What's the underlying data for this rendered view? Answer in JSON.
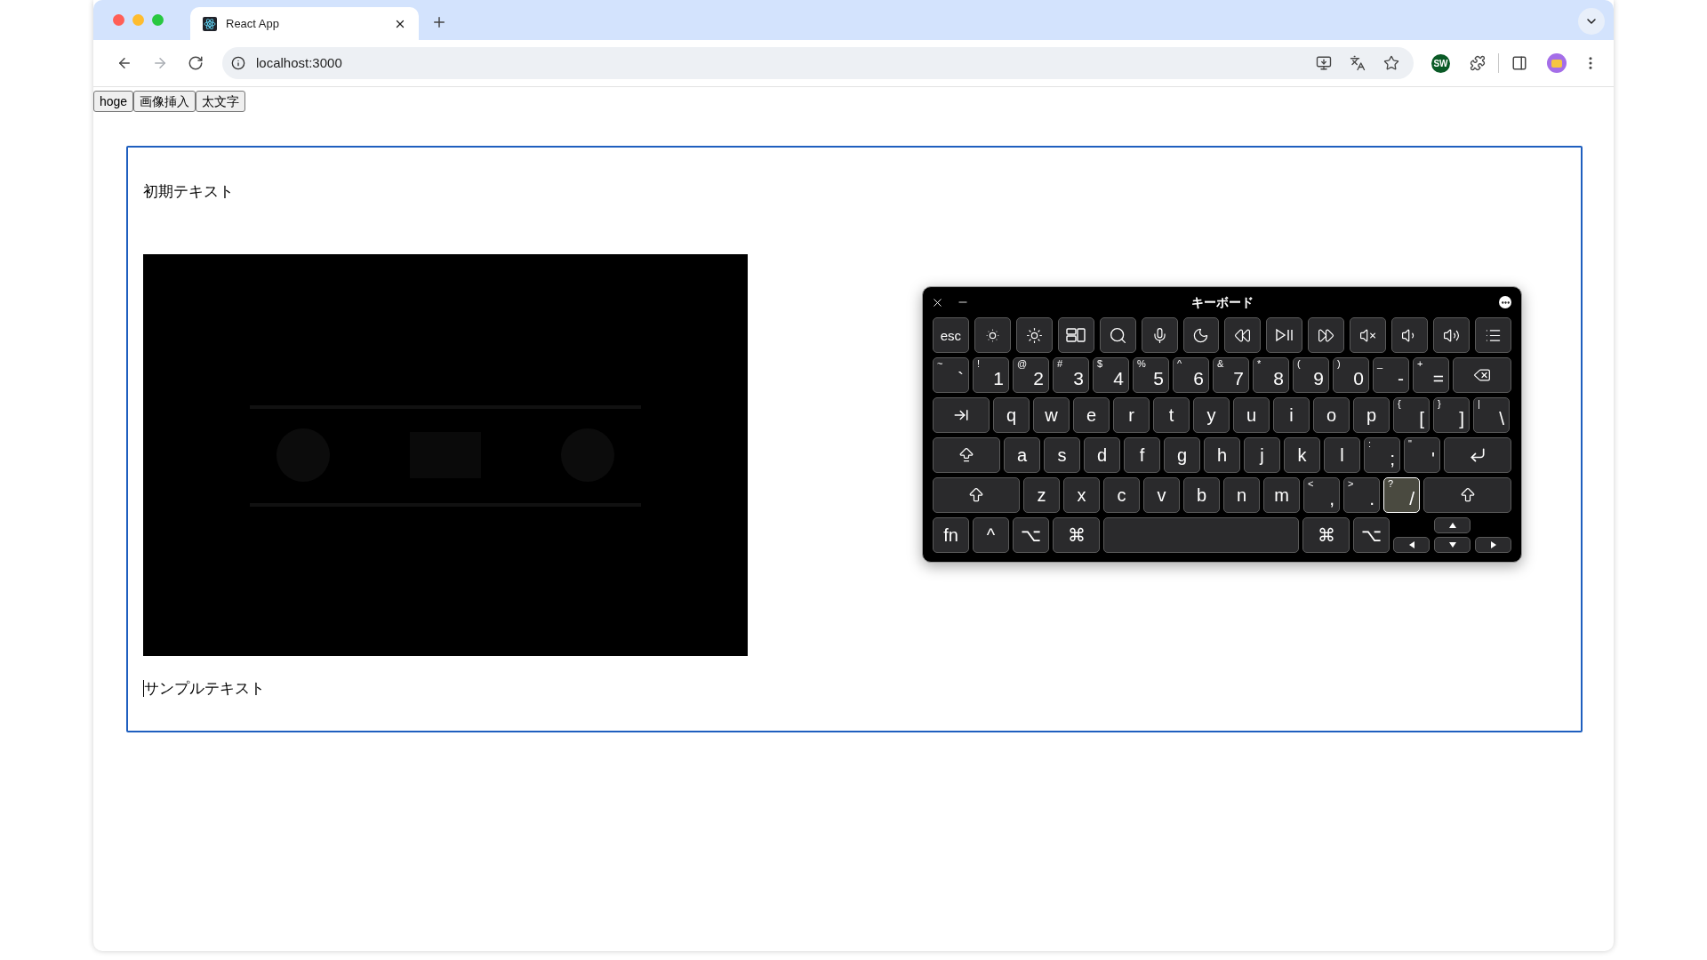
{
  "browser": {
    "tabs": [
      {
        "title": "React App",
        "selected": true
      }
    ],
    "nav": [
      {
        "kind": "back",
        "disabled": false
      },
      {
        "kind": "forward",
        "disabled": true
      },
      {
        "kind": "reload",
        "disabled": false
      }
    ],
    "address": "localhost:3000",
    "extension_badge": "SW"
  },
  "toolbar": {
    "buttons": [
      "hoge",
      "画像挿入",
      "太文字"
    ]
  },
  "editor": {
    "blocks": [
      {
        "kind": "text",
        "text": "初期テキスト",
        "caret": false
      },
      {
        "kind": "picture"
      },
      {
        "kind": "text",
        "text": "サンプルテキスト",
        "caret": true
      }
    ]
  },
  "keyboard": {
    "title": "キーボード",
    "key_rows": [
      [
        {
          "kind": "label",
          "text": "esc",
          "pressed": false
        },
        {
          "kind": "brightness-down",
          "pressed": false
        },
        {
          "kind": "brightness-up",
          "pressed": false
        },
        {
          "kind": "mission-control",
          "pressed": false
        },
        {
          "kind": "search",
          "pressed": false
        },
        {
          "kind": "mic",
          "pressed": false
        },
        {
          "kind": "moon",
          "pressed": false
        },
        {
          "kind": "rewind",
          "pressed": false
        },
        {
          "kind": "play-pause",
          "pressed": false
        },
        {
          "kind": "fast-forward",
          "pressed": false
        },
        {
          "kind": "mute",
          "pressed": false
        },
        {
          "kind": "volume-down",
          "pressed": false
        },
        {
          "kind": "volume-up",
          "pressed": false
        },
        {
          "kind": "list",
          "pressed": false
        }
      ],
      [
        {
          "kind": "char",
          "main": "`",
          "shift": "~",
          "pressed": false
        },
        {
          "kind": "char",
          "main": "1",
          "shift": "!",
          "pressed": false
        },
        {
          "kind": "char",
          "main": "2",
          "shift": "@",
          "pressed": false
        },
        {
          "kind": "char",
          "main": "3",
          "shift": "#",
          "pressed": false
        },
        {
          "kind": "char",
          "main": "4",
          "shift": "$",
          "pressed": false
        },
        {
          "kind": "char",
          "main": "5",
          "shift": "%",
          "pressed": false
        },
        {
          "kind": "char",
          "main": "6",
          "shift": "^",
          "pressed": false
        },
        {
          "kind": "char",
          "main": "7",
          "shift": "&",
          "pressed": false
        },
        {
          "kind": "char",
          "main": "8",
          "shift": "*",
          "pressed": false
        },
        {
          "kind": "char",
          "main": "9",
          "shift": "(",
          "pressed": false
        },
        {
          "kind": "char",
          "main": "0",
          "shift": ")",
          "pressed": false
        },
        {
          "kind": "char",
          "main": "-",
          "shift": "_",
          "pressed": false
        },
        {
          "kind": "char",
          "main": "=",
          "shift": "+",
          "pressed": false
        },
        {
          "kind": "delete",
          "pressed": false
        }
      ],
      [
        {
          "kind": "tab",
          "pressed": false
        },
        {
          "kind": "char",
          "main": "q",
          "pressed": false
        },
        {
          "kind": "char",
          "main": "w",
          "pressed": false
        },
        {
          "kind": "char",
          "main": "e",
          "pressed": false
        },
        {
          "kind": "char",
          "main": "r",
          "pressed": false
        },
        {
          "kind": "char",
          "main": "t",
          "pressed": false
        },
        {
          "kind": "char",
          "main": "y",
          "pressed": false
        },
        {
          "kind": "char",
          "main": "u",
          "pressed": false
        },
        {
          "kind": "char",
          "main": "i",
          "pressed": false
        },
        {
          "kind": "char",
          "main": "o",
          "pressed": false
        },
        {
          "kind": "char",
          "main": "p",
          "pressed": false
        },
        {
          "kind": "char",
          "main": "[",
          "shift": "{",
          "pressed": false
        },
        {
          "kind": "char",
          "main": "]",
          "shift": "}",
          "pressed": false
        },
        {
          "kind": "char",
          "main": "\\",
          "shift": "|",
          "pressed": false
        }
      ],
      [
        {
          "kind": "caps",
          "pressed": false
        },
        {
          "kind": "char",
          "main": "a",
          "pressed": false
        },
        {
          "kind": "char",
          "main": "s",
          "pressed": false
        },
        {
          "kind": "char",
          "main": "d",
          "pressed": false
        },
        {
          "kind": "char",
          "main": "f",
          "pressed": false
        },
        {
          "kind": "char",
          "main": "g",
          "pressed": false
        },
        {
          "kind": "char",
          "main": "h",
          "pressed": false
        },
        {
          "kind": "char",
          "main": "j",
          "pressed": false
        },
        {
          "kind": "char",
          "main": "k",
          "pressed": false
        },
        {
          "kind": "char",
          "main": "l",
          "pressed": false
        },
        {
          "kind": "char",
          "main": ";",
          "shift": ":",
          "pressed": false
        },
        {
          "kind": "char",
          "main": "'",
          "shift": "\"",
          "pressed": false
        },
        {
          "kind": "return",
          "pressed": false
        }
      ],
      [
        {
          "kind": "shift",
          "pressed": false
        },
        {
          "kind": "char",
          "main": "z",
          "pressed": false
        },
        {
          "kind": "char",
          "main": "x",
          "pressed": false
        },
        {
          "kind": "char",
          "main": "c",
          "pressed": false
        },
        {
          "kind": "char",
          "main": "v",
          "pressed": false
        },
        {
          "kind": "char",
          "main": "b",
          "pressed": false
        },
        {
          "kind": "char",
          "main": "n",
          "pressed": false
        },
        {
          "kind": "char",
          "main": "m",
          "pressed": false
        },
        {
          "kind": "char",
          "main": ",",
          "shift": "<",
          "pressed": false
        },
        {
          "kind": "char",
          "main": ".",
          "shift": ">",
          "pressed": false
        },
        {
          "kind": "char",
          "main": "/",
          "shift": "?",
          "pressed": true
        },
        {
          "kind": "shift",
          "pressed": false
        }
      ],
      [
        {
          "kind": "label",
          "text": "fn",
          "pressed": false
        },
        {
          "kind": "label",
          "text": "^",
          "pressed": false
        },
        {
          "kind": "label",
          "text": "⌥",
          "pressed": false
        },
        {
          "kind": "command",
          "text": "⌘",
          "pressed": false
        },
        {
          "kind": "space",
          "pressed": false
        },
        {
          "kind": "command",
          "text": "⌘",
          "pressed": false
        },
        {
          "kind": "label",
          "text": "⌥",
          "pressed": false
        },
        {
          "kind": "arrows",
          "keys": [
            {
              "kind": "arrow-up",
              "pressed": false
            },
            {
              "kind": "arrow-left",
              "pressed": false
            },
            {
              "kind": "arrow-down",
              "pressed": false
            },
            {
              "kind": "arrow-right",
              "pressed": false
            }
          ]
        }
      ]
    ]
  }
}
